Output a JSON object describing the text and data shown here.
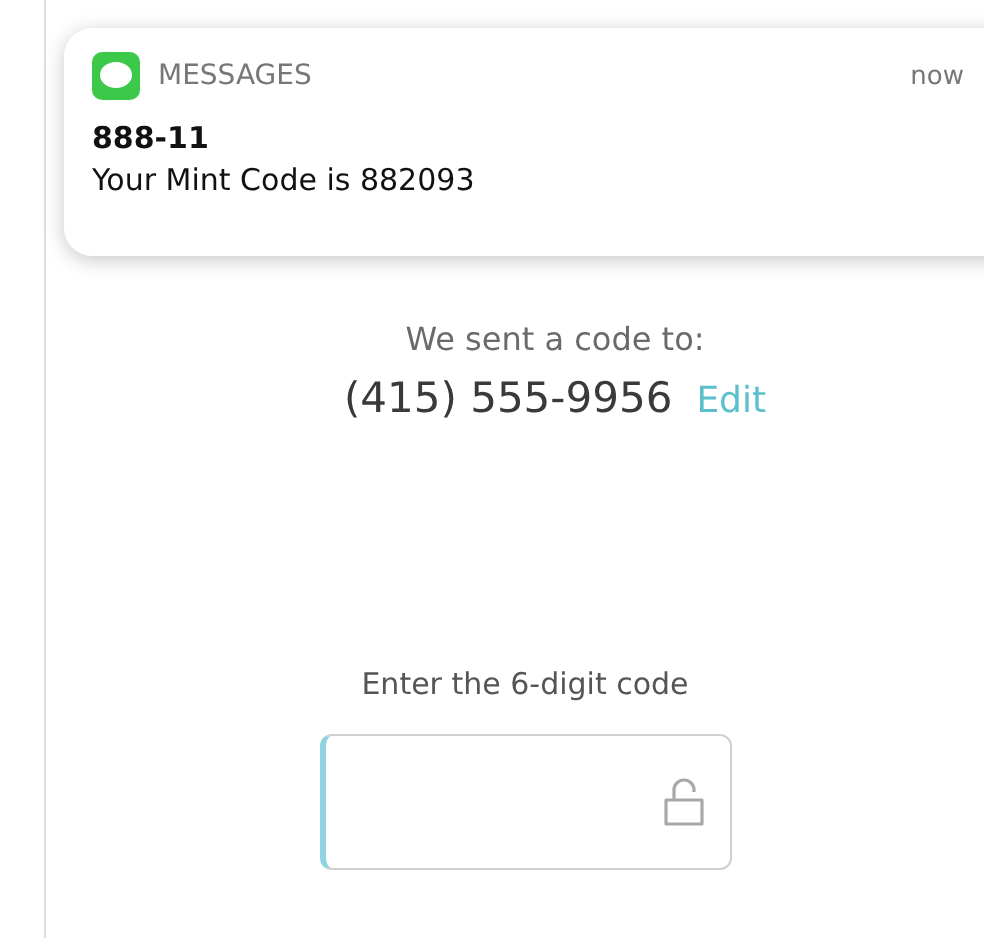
{
  "notification": {
    "app": "MESSAGES",
    "time": "now",
    "sender": "888-11",
    "message": "Your Mint Code is 882093"
  },
  "sent_to": {
    "label": "We sent a code to:",
    "phone": "(415) 555-9956",
    "edit": "Edit"
  },
  "code_entry": {
    "label": "Enter the 6-digit code",
    "focused": true
  }
}
